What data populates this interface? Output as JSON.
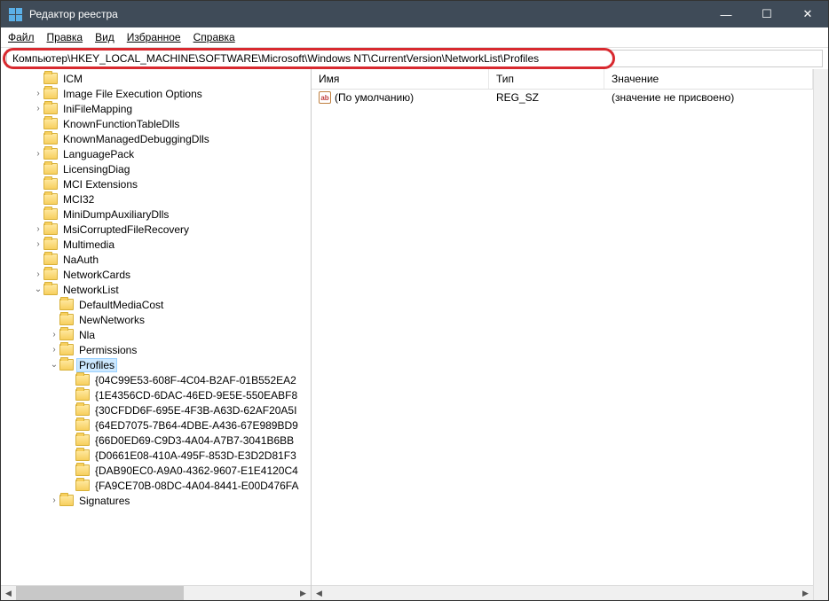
{
  "titlebar": {
    "title": "Редактор реестра"
  },
  "menubar": {
    "file": "Файл",
    "edit": "Правка",
    "view": "Вид",
    "favorites": "Избранное",
    "help": "Справка"
  },
  "addressbar": {
    "value": "Компьютер\\HKEY_LOCAL_MACHINE\\SOFTWARE\\Microsoft\\Windows NT\\CurrentVersion\\NetworkList\\Profiles"
  },
  "tree": {
    "items": [
      {
        "indent": 2,
        "label": "ICM",
        "expander": ""
      },
      {
        "indent": 2,
        "label": "Image File Execution Options",
        "expander": ">"
      },
      {
        "indent": 2,
        "label": "IniFileMapping",
        "expander": ">"
      },
      {
        "indent": 2,
        "label": "KnownFunctionTableDlls",
        "expander": ""
      },
      {
        "indent": 2,
        "label": "KnownManagedDebuggingDlls",
        "expander": ""
      },
      {
        "indent": 2,
        "label": "LanguagePack",
        "expander": ">"
      },
      {
        "indent": 2,
        "label": "LicensingDiag",
        "expander": ""
      },
      {
        "indent": 2,
        "label": "MCI Extensions",
        "expander": ""
      },
      {
        "indent": 2,
        "label": "MCI32",
        "expander": ""
      },
      {
        "indent": 2,
        "label": "MiniDumpAuxiliaryDlls",
        "expander": ""
      },
      {
        "indent": 2,
        "label": "MsiCorruptedFileRecovery",
        "expander": ">"
      },
      {
        "indent": 2,
        "label": "Multimedia",
        "expander": ">"
      },
      {
        "indent": 2,
        "label": "NaAuth",
        "expander": ""
      },
      {
        "indent": 2,
        "label": "NetworkCards",
        "expander": ">"
      },
      {
        "indent": 2,
        "label": "NetworkList",
        "expander": "v"
      },
      {
        "indent": 3,
        "label": "DefaultMediaCost",
        "expander": ""
      },
      {
        "indent": 3,
        "label": "NewNetworks",
        "expander": ""
      },
      {
        "indent": 3,
        "label": "Nla",
        "expander": ">"
      },
      {
        "indent": 3,
        "label": "Permissions",
        "expander": ">"
      },
      {
        "indent": 3,
        "label": "Profiles",
        "expander": "v",
        "selected": true
      },
      {
        "indent": 4,
        "label": "{04C99E53-608F-4C04-B2AF-01B552EA2",
        "expander": ""
      },
      {
        "indent": 4,
        "label": "{1E4356CD-6DAC-46ED-9E5E-550EABF8",
        "expander": ""
      },
      {
        "indent": 4,
        "label": "{30CFDD6F-695E-4F3B-A63D-62AF20A5I",
        "expander": ""
      },
      {
        "indent": 4,
        "label": "{64ED7075-7B64-4DBE-A436-67E989BD9",
        "expander": ""
      },
      {
        "indent": 4,
        "label": "{66D0ED69-C9D3-4A04-A7B7-3041B6BB",
        "expander": ""
      },
      {
        "indent": 4,
        "label": "{D0661E08-410A-495F-853D-E3D2D81F3",
        "expander": ""
      },
      {
        "indent": 4,
        "label": "{DAB90EC0-A9A0-4362-9607-E1E4120C4",
        "expander": ""
      },
      {
        "indent": 4,
        "label": "{FA9CE70B-08DC-4A04-8441-E00D476FA",
        "expander": ""
      },
      {
        "indent": 3,
        "label": "Signatures",
        "expander": ">"
      }
    ]
  },
  "values": {
    "headers": {
      "name": "Имя",
      "type": "Тип",
      "data": "Значение"
    },
    "rows": [
      {
        "name": "(По умолчанию)",
        "type": "REG_SZ",
        "data": "(значение не присвоено)"
      }
    ]
  }
}
